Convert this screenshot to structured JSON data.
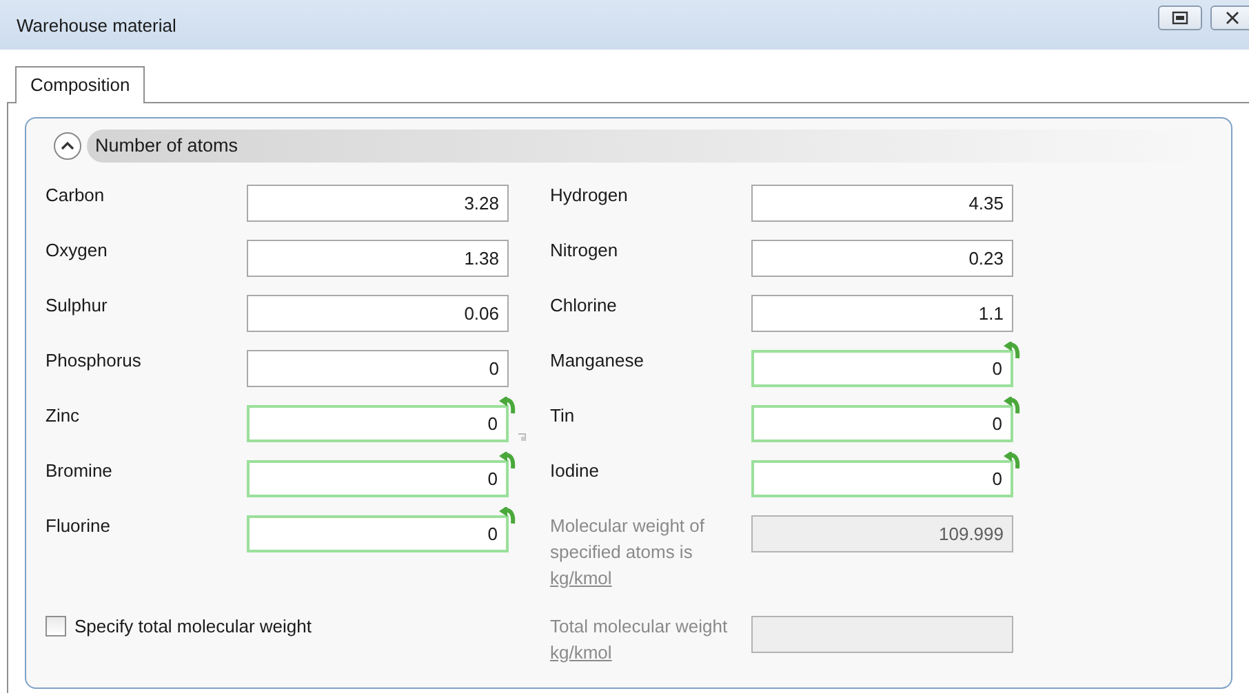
{
  "window": {
    "title": "Warehouse material"
  },
  "tabs": [
    {
      "label": "Composition",
      "selected": true
    }
  ],
  "section": {
    "title": "Number of atoms",
    "expanded": true
  },
  "fields_left": [
    {
      "label": "Carbon",
      "value": "3.28",
      "modified": false
    },
    {
      "label": "Oxygen",
      "value": "1.38",
      "modified": false
    },
    {
      "label": "Sulphur",
      "value": "0.06",
      "modified": false
    },
    {
      "label": "Phosphorus",
      "value": "0",
      "modified": false
    },
    {
      "label": "Zinc",
      "value": "0",
      "modified": true
    },
    {
      "label": "Bromine",
      "value": "0",
      "modified": true
    },
    {
      "label": "Fluorine",
      "value": "0",
      "modified": true
    }
  ],
  "fields_right": [
    {
      "label": "Hydrogen",
      "value": "4.35",
      "modified": false
    },
    {
      "label": "Nitrogen",
      "value": "0.23",
      "modified": false
    },
    {
      "label": "Chlorine",
      "value": "1.1",
      "modified": false
    },
    {
      "label": "Manganese",
      "value": "0",
      "modified": true
    },
    {
      "label": "Tin",
      "value": "0",
      "modified": true
    },
    {
      "label": "Iodine",
      "value": "0",
      "modified": true
    },
    {
      "label": "Molecular weight of specified atoms is",
      "unit": "kg/kmol",
      "value": "109.999",
      "disabled": true
    }
  ],
  "checkbox": {
    "label": "Specify total molecular weight",
    "checked": false
  },
  "total": {
    "label": "Total molecular weight",
    "unit": "kg/kmol",
    "disabled": true
  }
}
